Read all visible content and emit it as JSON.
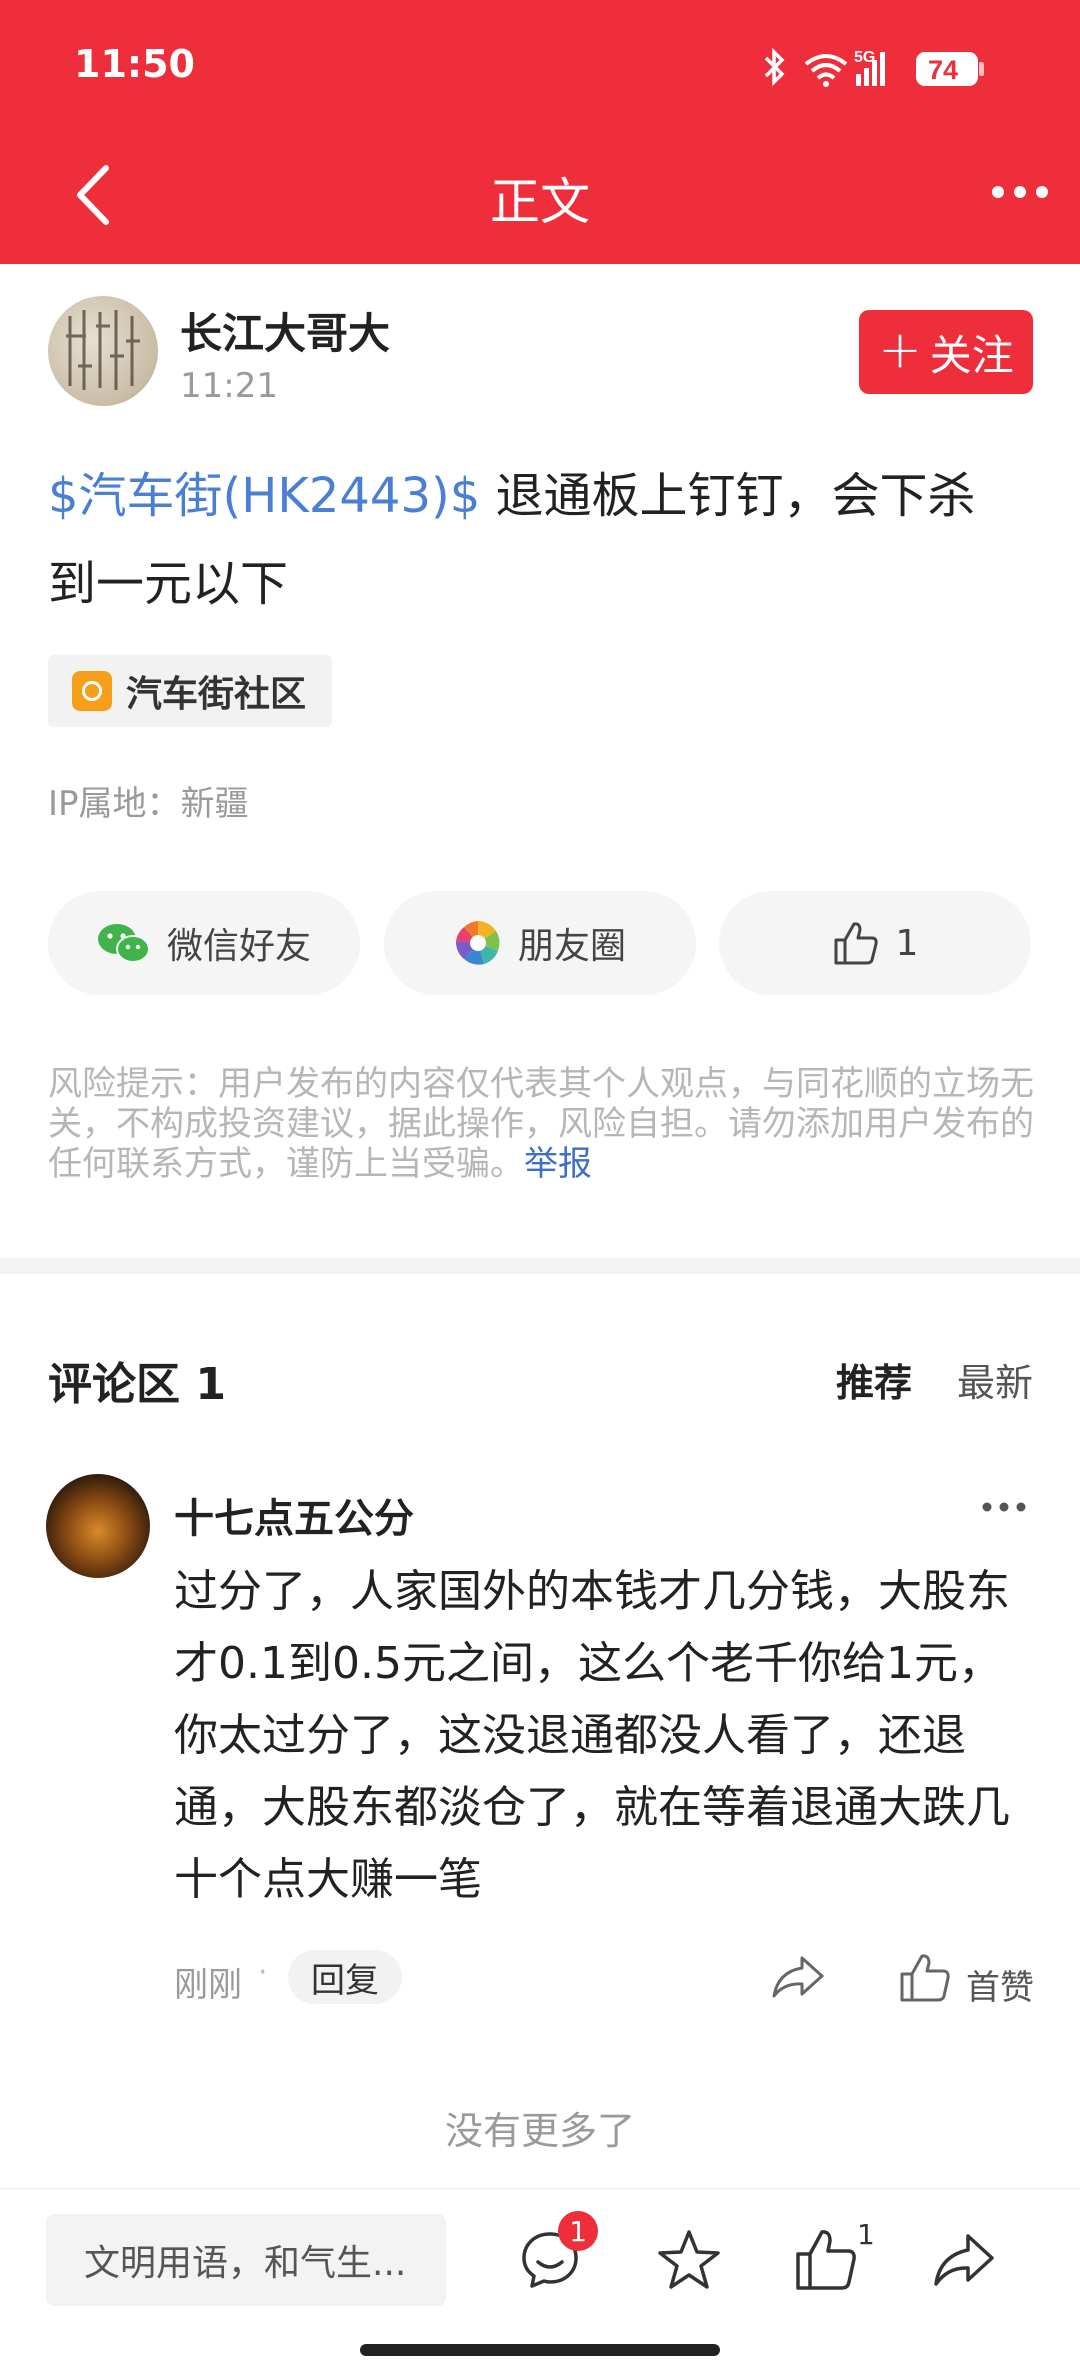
{
  "status_bar": {
    "time": "11:50",
    "network": "5G",
    "battery": "74",
    "icons": [
      "bluetooth-icon",
      "wifi-icon",
      "signal-icon",
      "battery-icon"
    ]
  },
  "nav": {
    "title": "正文",
    "back_icon": "chevron-left-icon",
    "more_icon": "more-dots-icon"
  },
  "post": {
    "author": "长江大哥大",
    "time": "11:21",
    "follow_label": "关注",
    "stock_link": "$汽车街(HK2443)$",
    "text_line1": " 退通板上钉钉，会下杀",
    "text_line2": "到一元以下",
    "community": "汽车街社区",
    "ip_location": "IP属地：新疆"
  },
  "actions": {
    "wechat_label": "微信好友",
    "moments_label": "朋友圈",
    "like_count": "1"
  },
  "risk": {
    "text": "风险提示：用户发布的内容仅代表其个人观点，与同花顺的立场无关，不构成投资建议，据此操作，风险自担。请勿添加用户发布的任何联系方式，谨防上当受骗。",
    "report_label": "举报"
  },
  "comments": {
    "title": "评论区 1",
    "sort_recommend": "推荐",
    "sort_latest": "最新",
    "items": [
      {
        "name": "十七点五公分",
        "text": "过分了，人家国外的本钱才几分钱，大股东才0.1到0.5元之间，这么个老千你给1元，你太过分了，这没退通都没人看了，还退通，大股东都淡仓了，就在等着退通大跌几十个点大赚一笔",
        "time": "刚刚",
        "separator": "·",
        "reply_label": "回复",
        "like_label": "首赞"
      }
    ],
    "no_more": "没有更多了"
  },
  "bottom_bar": {
    "input_placeholder": "文明用语，和气生...",
    "comment_badge": "1",
    "like_count": "1"
  },
  "colors": {
    "brand_red": "#ee2f3b",
    "link_blue": "#4a7fd4",
    "community_orange": "#f6a019"
  }
}
